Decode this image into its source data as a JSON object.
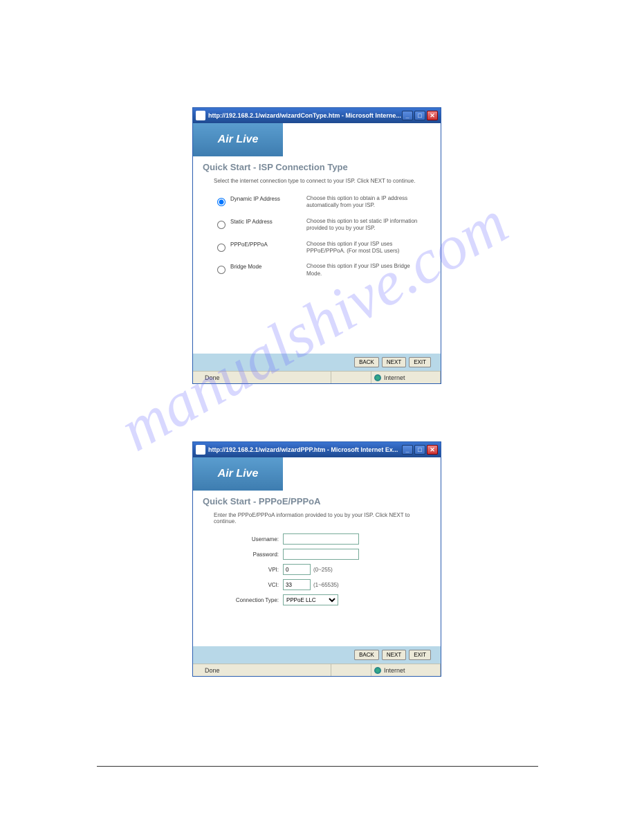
{
  "watermark": "manualshive.com",
  "window1": {
    "url_title": "http://192.168.2.1/wizard/wizardConType.htm - Microsoft Interne...",
    "logo": "Air Live",
    "heading": "Quick Start - ISP Connection Type",
    "instruction": "Select the internet connection type to connect to your ISP. Click NEXT to continue.",
    "options": [
      {
        "label": "Dynamic IP Address",
        "desc": "Choose this option to obtain a IP address automatically from your ISP.",
        "checked": true
      },
      {
        "label": "Static IP Address",
        "desc": "Choose this option to set static IP information provided to you by your ISP.",
        "checked": false
      },
      {
        "label": "PPPoE/PPPoA",
        "desc": "Choose this option if your ISP uses PPPoE/PPPoA. (For most DSL users)",
        "checked": false
      },
      {
        "label": "Bridge Mode",
        "desc": "Choose this option if your ISP uses Bridge Mode.",
        "checked": false
      }
    ],
    "buttons": {
      "back": "BACK",
      "next": "NEXT",
      "exit": "EXIT"
    },
    "status_left": "Done",
    "status_zone": "Internet"
  },
  "window2": {
    "url_title": "http://192.168.2.1/wizard/wizardPPP.htm - Microsoft Internet Ex...",
    "logo": "Air Live",
    "heading": "Quick Start - PPPoE/PPPoA",
    "instruction": "Enter the PPPoE/PPPoA information provided to you by your ISP. Click NEXT to continue.",
    "fields": {
      "username_label": "Username:",
      "username_value": "",
      "password_label": "Password:",
      "password_value": "",
      "vpi_label": "VPI:",
      "vpi_value": "0",
      "vpi_note": "(0~255)",
      "vci_label": "VCI:",
      "vci_value": "33",
      "vci_note": "(1~65535)",
      "conntype_label": "Connection Type:",
      "conntype_value": "PPPoE LLC"
    },
    "buttons": {
      "back": "BACK",
      "next": "NEXT",
      "exit": "EXIT"
    },
    "status_left": "Done",
    "status_zone": "Internet"
  }
}
